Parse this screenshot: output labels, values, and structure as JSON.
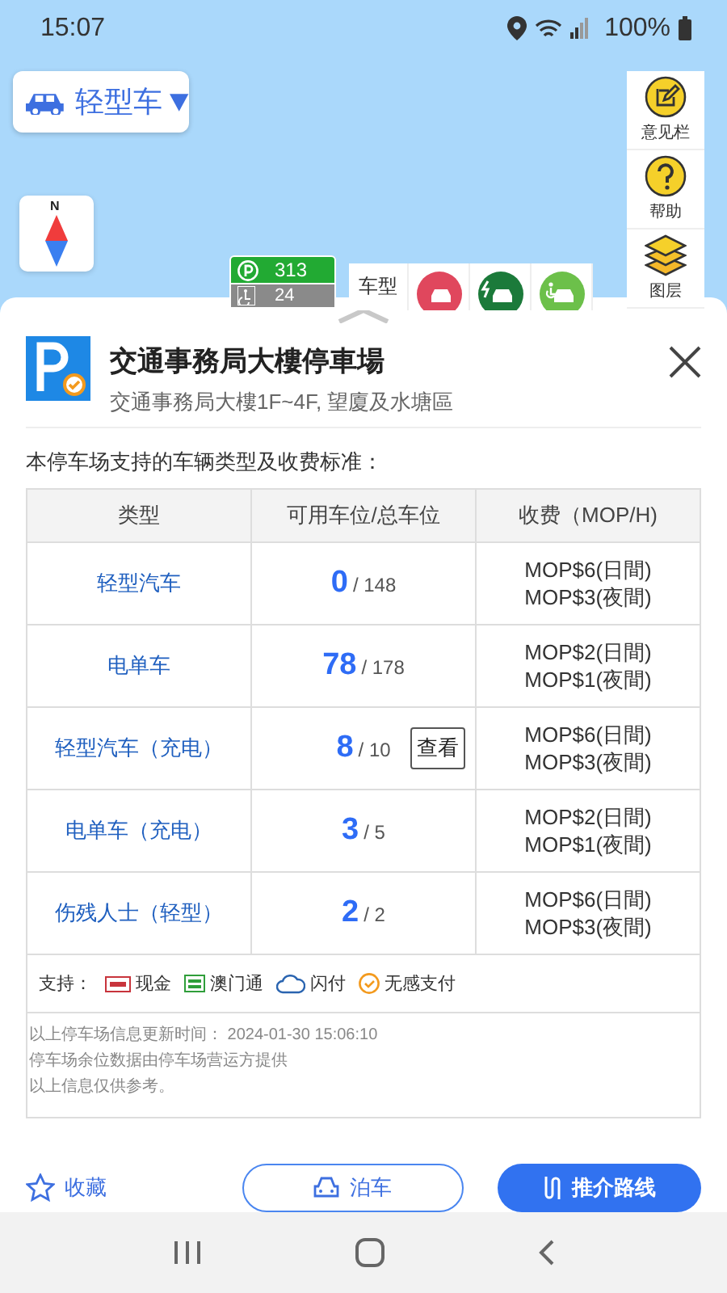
{
  "status_bar": {
    "time": "15:07",
    "battery": "100%"
  },
  "map": {
    "vehicle_selector": {
      "label": "轻型车"
    },
    "compass": {
      "label": "N"
    },
    "tools": [
      {
        "kind": "feedback",
        "label": "意见栏"
      },
      {
        "kind": "help",
        "label": "帮助"
      },
      {
        "kind": "layers",
        "label": "图层"
      }
    ],
    "marker": {
      "spaces": "313",
      "accessible": "24"
    },
    "legend": {
      "label": "车型",
      "items": [
        {
          "kind": "car",
          "color": "#e0475d"
        },
        {
          "kind": "ev",
          "color": "#1b7a3a"
        },
        {
          "kind": "accessible",
          "color": "#6cc04a"
        }
      ]
    }
  },
  "sheet": {
    "title": "交通事務局大樓停車場",
    "address": "交通事務局大樓1F~4F, 望廈及水塘區",
    "intro": "本停车场支持的车辆类型及收费标准：",
    "table": {
      "columns": [
        "类型",
        "可用车位/总车位",
        "收费（MOP/H)"
      ],
      "rows": [
        {
          "type": "轻型汽车",
          "available": "0",
          "total": "/ 148",
          "fees": [
            "MOP$6(日間)",
            "MOP$3(夜間)"
          ]
        },
        {
          "type": "电单车",
          "available": "78",
          "total": "/ 178",
          "fees": [
            "MOP$2(日間)",
            "MOP$1(夜間)"
          ]
        },
        {
          "type": "轻型汽车（充电）",
          "available": "8",
          "total": "/ 10",
          "action": "查看",
          "fees": [
            "MOP$6(日間)",
            "MOP$3(夜間)"
          ]
        },
        {
          "type": "电单车（充电）",
          "available": "3",
          "total": "/ 5",
          "fees": [
            "MOP$2(日間)",
            "MOP$1(夜間)"
          ]
        },
        {
          "type": "伤残人士（轻型）",
          "available": "2",
          "total": "/ 2",
          "fees": [
            "MOP$6(日間)",
            "MOP$3(夜間)"
          ]
        }
      ]
    },
    "payments": {
      "label": "支持：",
      "methods": [
        {
          "kind": "cash",
          "label": "现金"
        },
        {
          "kind": "card",
          "label": "澳门通"
        },
        {
          "kind": "cloud",
          "label": "闪付"
        },
        {
          "kind": "auto",
          "label": "无感支付"
        }
      ]
    },
    "notes": [
      "以上停车场信息更新时间： 2024-01-30 15:06:10",
      "停车场余位数据由停车场营运方提供",
      "以上信息仅供参考。"
    ],
    "actions": {
      "favorite": "收藏",
      "park": "泊车",
      "route": "推介路线"
    }
  }
}
